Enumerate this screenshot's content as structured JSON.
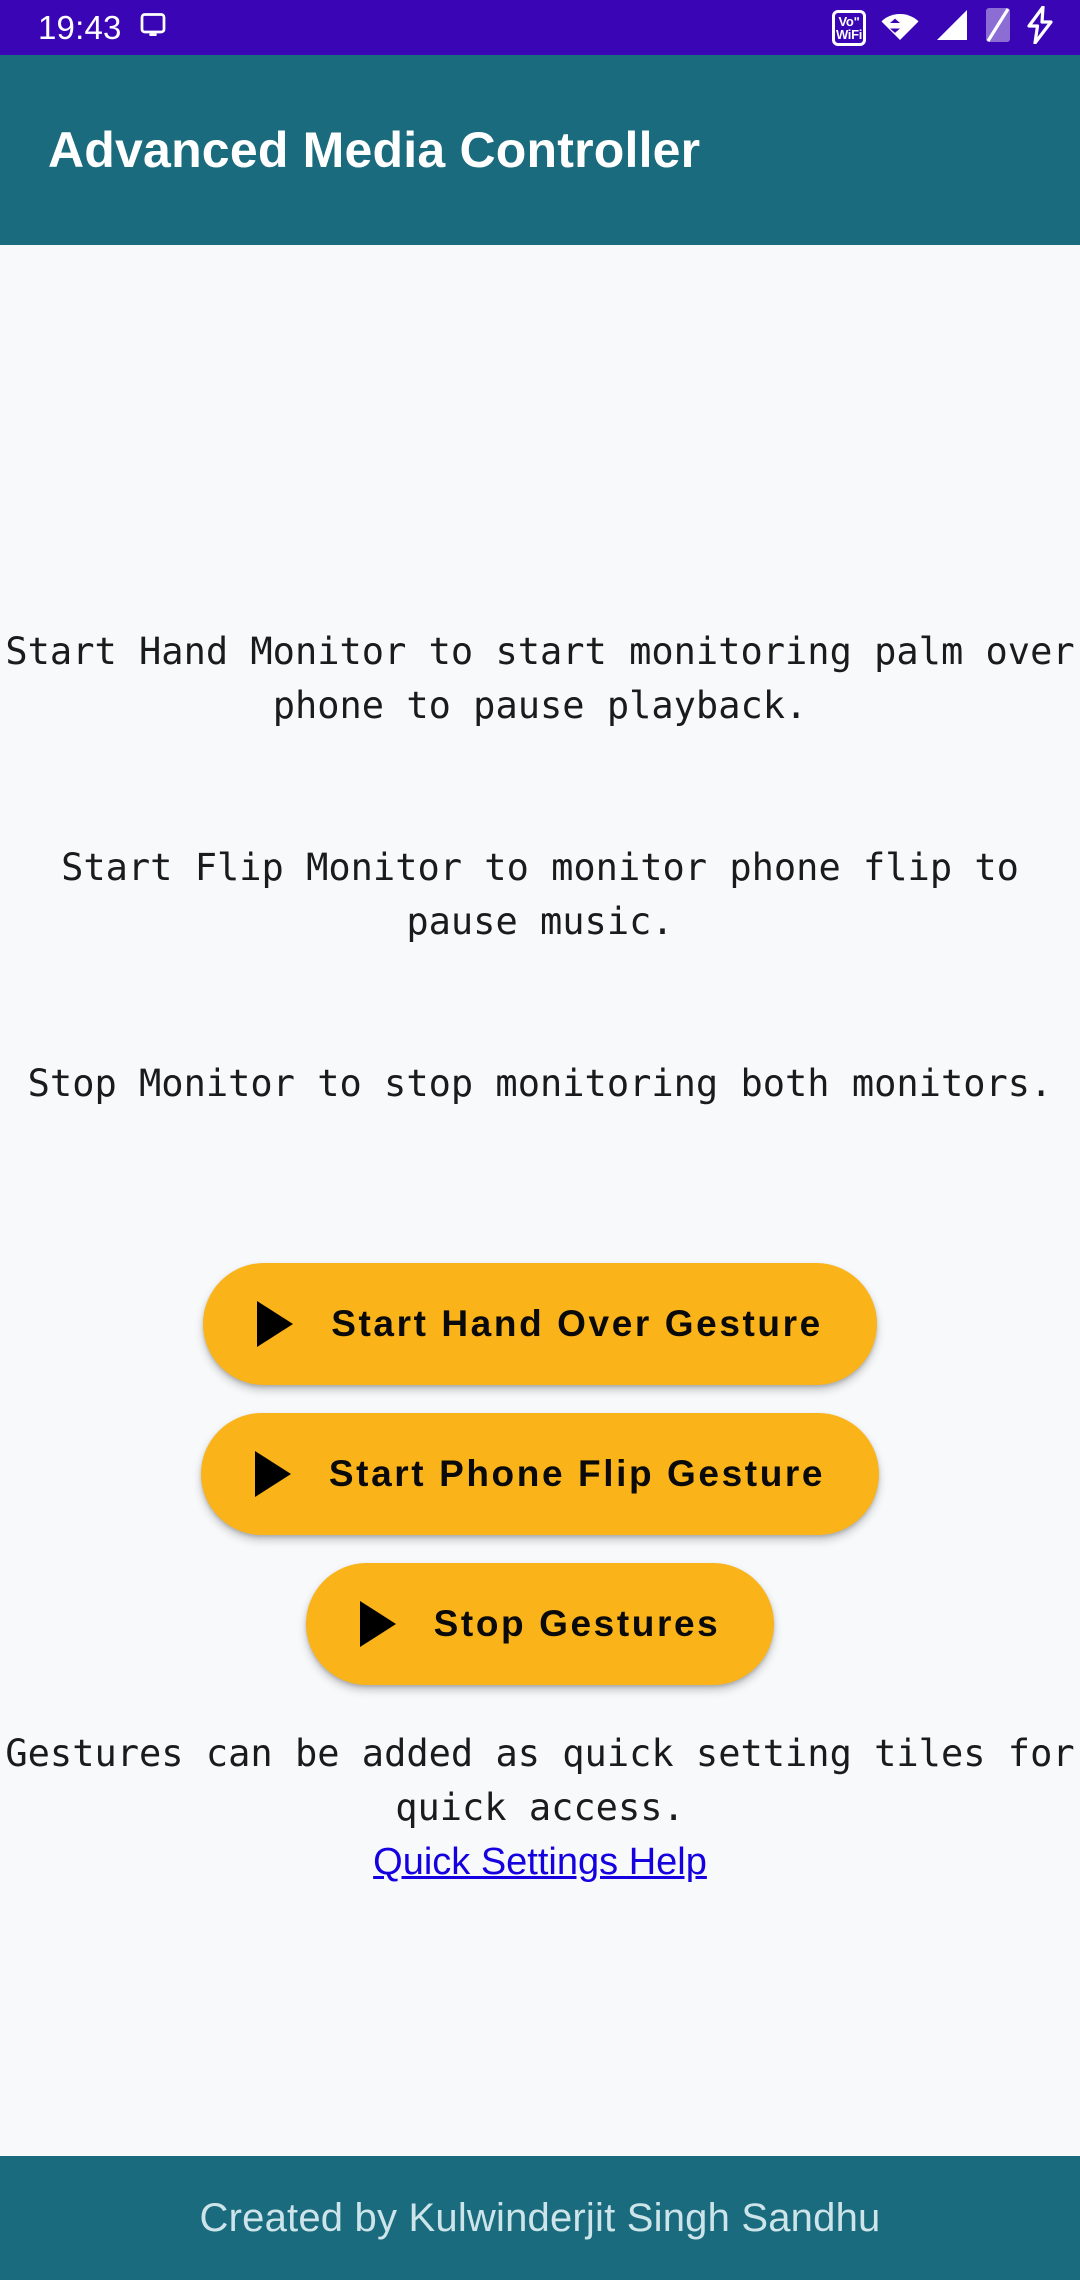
{
  "status_bar": {
    "time": "19:43",
    "background_color": "#3a05b5",
    "icons": [
      {
        "name": "cast-icon",
        "label": "cast"
      },
      {
        "name": "vowifi-icon",
        "label_top": "Voʺ",
        "label_bottom": "WiFi"
      },
      {
        "name": "wifi-icon",
        "label": "wifi"
      },
      {
        "name": "signal-icon",
        "label": "cellular-signal"
      },
      {
        "name": "sim-icon",
        "label": "sim-card"
      },
      {
        "name": "charging-bolt-icon",
        "label": "charging"
      }
    ]
  },
  "app_bar": {
    "title": "Advanced Media Controller",
    "background_color": "#1a6b7d",
    "text_color": "#ffffff"
  },
  "main": {
    "background_color": "#f7f9fb",
    "instructions": [
      "Start Hand Monitor to start monitoring palm over phone to pause playback.",
      "Start Flip Monitor to monitor phone flip to pause music.",
      "Stop Monitor to stop monitoring both monitors."
    ],
    "buttons": [
      {
        "name": "start-hand-over-gesture-button",
        "icon": "play-icon",
        "label": "Start Hand Over Gesture"
      },
      {
        "name": "start-phone-flip-gesture-button",
        "icon": "play-icon",
        "label": "Start Phone Flip Gesture"
      },
      {
        "name": "stop-gestures-button",
        "icon": "play-icon",
        "label": "Stop Gestures"
      }
    ],
    "button_color": "#fab318",
    "button_text_color": "#0a0a0a",
    "quick_tile_note": "Gestures can be added as quick setting tiles for quick access.",
    "help_link": {
      "label": "Quick Settings Help",
      "color": "#1500e0"
    }
  },
  "bottom_bar": {
    "credit": "Created by Kulwinderjit Singh Sandhu",
    "background_color": "#1a6b7d",
    "text_color": "#cde4ea"
  }
}
